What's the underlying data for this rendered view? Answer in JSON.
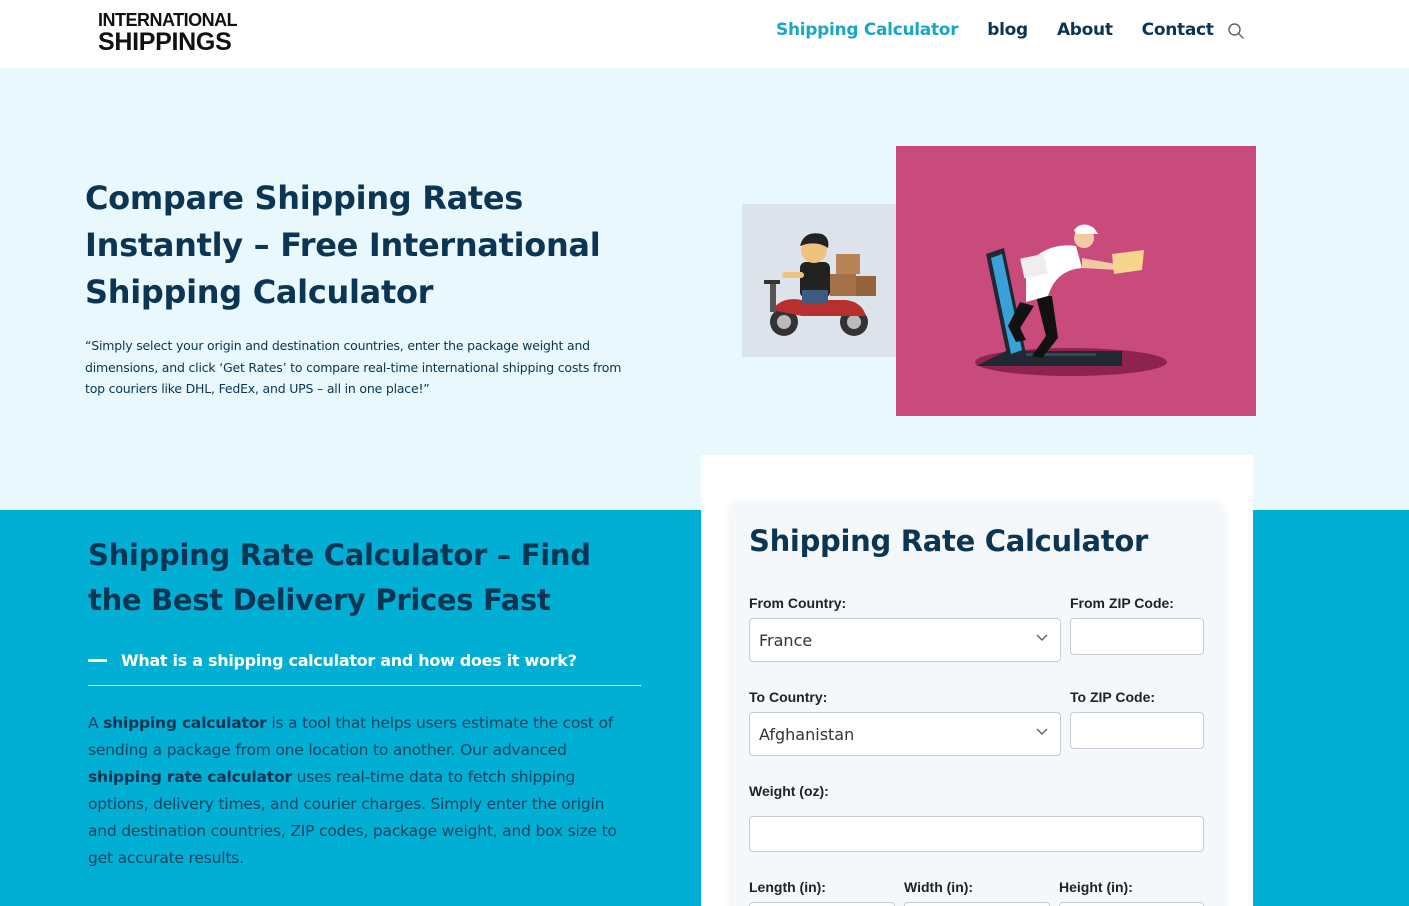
{
  "header": {
    "logo_line1": "INTERNATIONAL",
    "logo_line2": "SHIPPINGS",
    "nav": [
      "Shipping Calculator",
      "blog",
      "About",
      "Contact"
    ],
    "active_nav": "Shipping Calculator",
    "search_icon": "search-icon"
  },
  "hero": {
    "title": "Compare Shipping Rates Instantly – Free International Shipping Calculator",
    "description": "“Simply select your origin and destination countries, enter the package weight and dimensions, and click ‘Get Rates’ to compare real-time international shipping costs from top couriers like DHL, FedEx, and UPS – all in one place!”"
  },
  "section": {
    "title": "Shipping Rate Calculator – Find the Best Delivery Prices Fast",
    "faq_question": "What is a shipping calculator and how does it work?",
    "faq_answer": {
      "t1": "A ",
      "b1": "shipping calculator",
      "t2": " is a tool that helps users estimate the cost of sending a package from one location to another. Our advanced ",
      "b2": "shipping rate calculator",
      "t3": " uses real-time data to fetch shipping options, delivery times, and courier charges. Simply enter the origin and destination countries, ZIP codes, package weight, and box size to get accurate results."
    }
  },
  "calculator": {
    "title": "Shipping Rate Calculator",
    "from_country_label": "From Country:",
    "from_country_value": "France",
    "from_zip_label": "From ZIP Code:",
    "from_zip_value": "",
    "to_country_label": "To Country:",
    "to_country_value": "Afghanistan",
    "to_zip_label": "To ZIP Code:",
    "to_zip_value": "",
    "weight_label": "Weight (oz):",
    "weight_value": "",
    "length_label": "Length (in):",
    "width_label": "Width (in):",
    "height_label": "Height (in):"
  },
  "colors": {
    "navy": "#0b3552",
    "accent": "#19a6c9",
    "section_bg": "#00afd3",
    "hero_bg": "#e8f8fc",
    "image_magenta": "#c94b7c"
  }
}
